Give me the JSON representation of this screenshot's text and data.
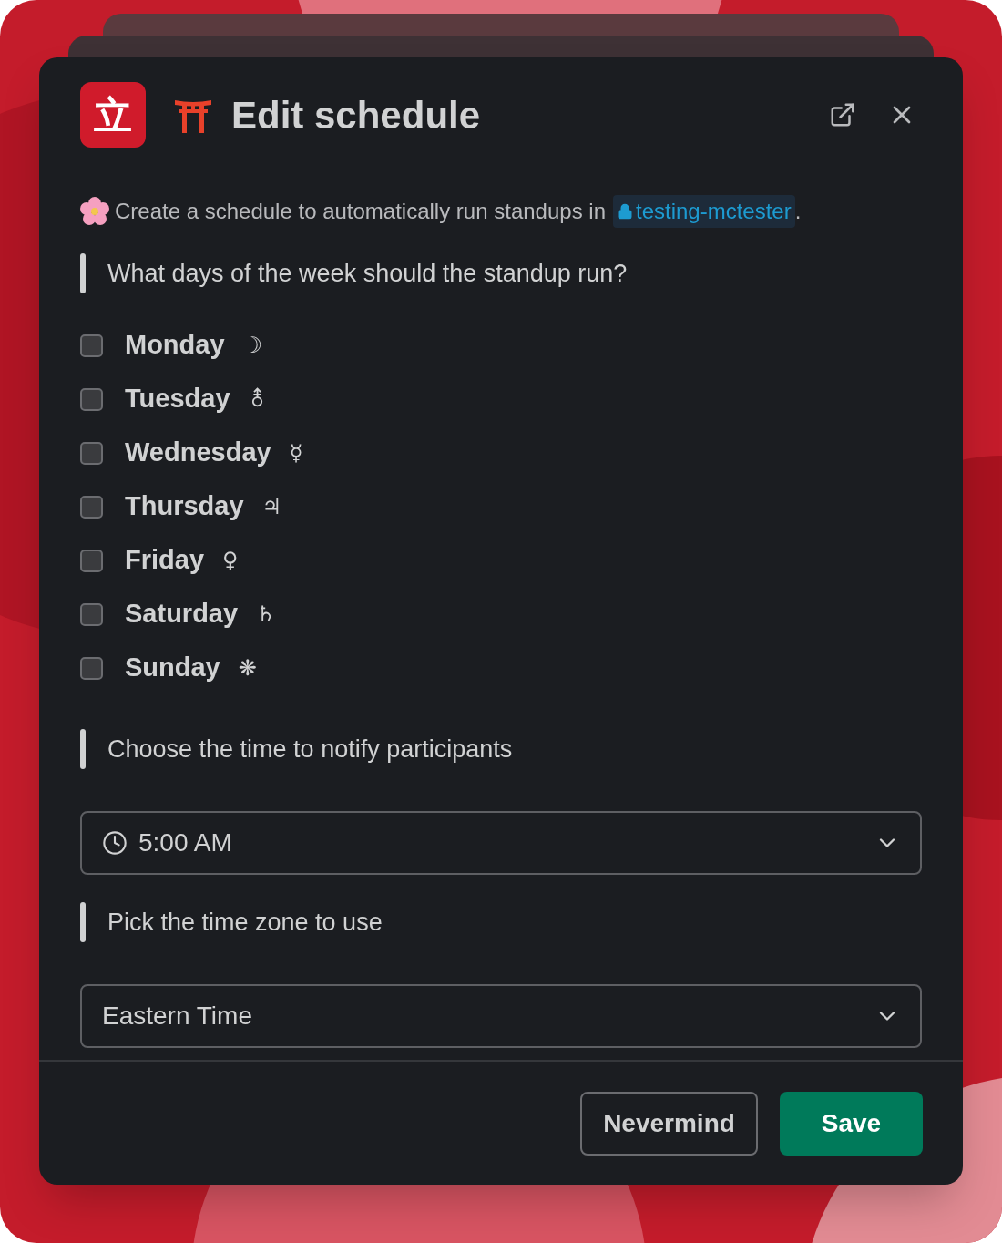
{
  "modal": {
    "app_icon": "立",
    "title": "Edit schedule"
  },
  "intro": {
    "text": "Create a schedule to automatically run standups in",
    "channel": "testing-mctester",
    "suffix": "."
  },
  "days_question": "What days of the week should the standup run?",
  "days": [
    {
      "label": "Monday",
      "symbol": "☽",
      "checked": false
    },
    {
      "label": "Tuesday",
      "symbol": "⚨",
      "checked": false
    },
    {
      "label": "Wednesday",
      "symbol": "☿",
      "checked": false
    },
    {
      "label": "Thursday",
      "symbol": "♃",
      "checked": false
    },
    {
      "label": "Friday",
      "symbol": "♀",
      "checked": false
    },
    {
      "label": "Saturday",
      "symbol": "♄",
      "checked": false
    },
    {
      "label": "Sunday",
      "symbol": "❋",
      "checked": false
    }
  ],
  "time_question": "Choose the time to notify participants",
  "time_select": {
    "value": "5:00 AM"
  },
  "zone_question": "Pick the time zone to use",
  "zone_select": {
    "value": "Eastern Time"
  },
  "footer": {
    "buttons": [
      {
        "label": "Nevermind",
        "kind": "secondary"
      },
      {
        "label": "Save",
        "kind": "primary"
      }
    ]
  }
}
